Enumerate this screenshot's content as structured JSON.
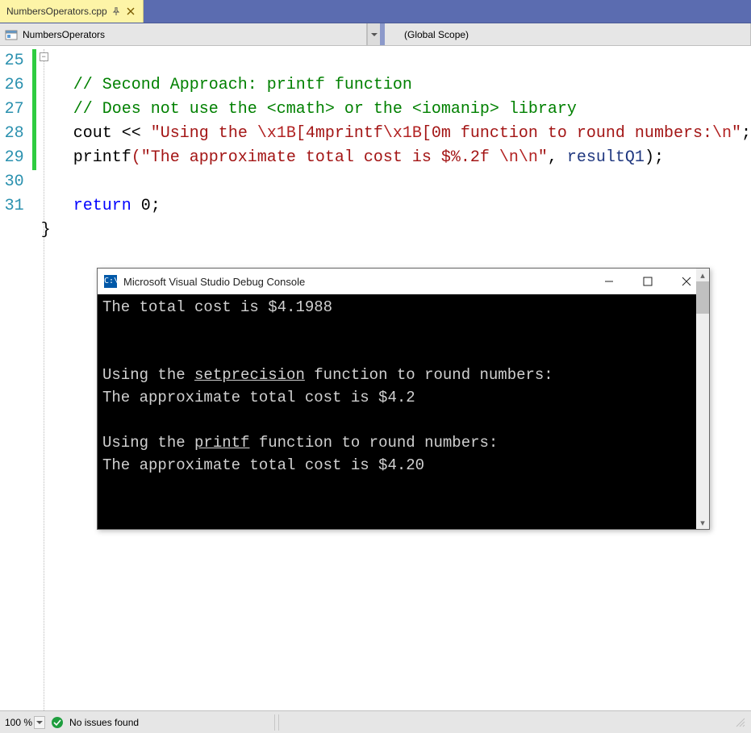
{
  "tab": {
    "filename": "NumbersOperators.cpp"
  },
  "scopebar": {
    "left_label": "NumbersOperators",
    "right_label": "(Global Scope)"
  },
  "code": {
    "line_numbers": [
      25,
      26,
      27,
      28,
      29,
      30,
      31
    ],
    "line25_comment": "// Second Approach: printf function",
    "line26_comment": "// Does not use the <cmath> or the <iomanip> library",
    "line27": {
      "cout": "cout",
      "op": " << ",
      "str1": "\"Using the ",
      "esc1": "\\x1B",
      "str2": "[4mprintf",
      "esc2": "\\x1B",
      "str3": "[0m function to round numbers:",
      "esc3": "\\n",
      "str4": "\"",
      "semi": ";"
    },
    "line28": {
      "fn": "printf",
      "str1": "(\"The approximate total cost is $%.2f ",
      "esc1": "\\n",
      "esc2": "\\n",
      "str2": "\"",
      "comma": ", ",
      "var": "resultQ1",
      "semi": ");"
    },
    "line30": {
      "kw": "return",
      "sp": " ",
      "val": "0",
      "semi": ";"
    },
    "line31_brace": "}"
  },
  "console": {
    "title": "Microsoft Visual Studio Debug Console",
    "icon_text": "C:\\",
    "lines": [
      {
        "t": "The total cost is $4.1988"
      },
      {
        "t": ""
      },
      {
        "t": ""
      },
      {
        "pre": "Using the ",
        "ul": "setprecision",
        "post": " function to round numbers:"
      },
      {
        "t": "The approximate total cost is $4.2"
      },
      {
        "t": ""
      },
      {
        "pre": "Using the ",
        "ul": "printf",
        "post": " function to round numbers:"
      },
      {
        "t": "The approximate total cost is $4.20"
      }
    ]
  },
  "statusbar": {
    "zoom": "100 %",
    "issues": "No issues found"
  }
}
